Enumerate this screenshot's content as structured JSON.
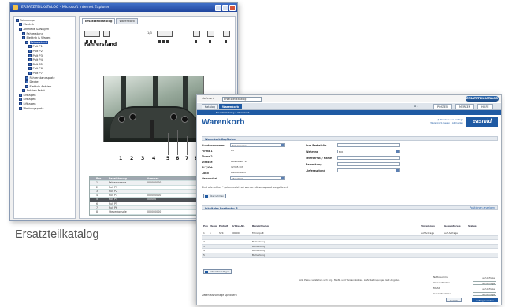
{
  "catalog": {
    "window_title": "ERSATZTEILKATALOG - Microsoft Internet Explorer",
    "tabs": [
      "Ersatzteilkatalog",
      "Warenkorb"
    ],
    "page_counter": "1/3",
    "section_title": "Fahrerstand",
    "callouts": [
      "1",
      "2",
      "3",
      "4",
      "5",
      "6",
      "7",
      "8",
      "9"
    ],
    "tree": [
      {
        "label": "Fahrzeuge",
        "indent": 0
      },
      {
        "label": "Elektrik",
        "indent": 1
      },
      {
        "label": "Antriebe & Wagen",
        "indent": 1
      },
      {
        "label": "Fahrerstand",
        "indent": 2
      },
      {
        "label": "Elektrik & Wagen",
        "indent": 2
      },
      {
        "label": "Fahrerstand",
        "indent": 3,
        "selected": true
      },
      {
        "label": "Pult P1",
        "indent": 4
      },
      {
        "label": "Pult P2",
        "indent": 4
      },
      {
        "label": "Pult P3",
        "indent": 4
      },
      {
        "label": "Pult P4",
        "indent": 4
      },
      {
        "label": "Pult P5",
        "indent": 4
      },
      {
        "label": "Pult P6",
        "indent": 4
      },
      {
        "label": "Pult P7",
        "indent": 4
      },
      {
        "label": "Fahrerstandsplatz",
        "indent": 3
      },
      {
        "label": "Decke",
        "indent": 3
      },
      {
        "label": "Elektrik Antrieb",
        "indent": 3
      },
      {
        "label": "Antrieb Fahrt",
        "indent": 2
      },
      {
        "label": "Lifttagen",
        "indent": 1
      },
      {
        "label": "Lifttagen",
        "indent": 1
      },
      {
        "label": "Lifttagen",
        "indent": 1
      },
      {
        "label": "Wartungsplatz",
        "indent": 1
      }
    ],
    "parts_table": {
      "header": [
        "",
        "Pos.",
        "Bezeichnung",
        "Nummer"
      ],
      "rows": [
        [
          "",
          "1",
          "Fahrerkonsole",
          "000000000"
        ],
        [
          "",
          "2",
          "Pult P1",
          ""
        ],
        [
          "",
          "3",
          "Pult P2",
          ""
        ],
        [
          "",
          "4",
          "Pult P3",
          "000000000"
        ],
        [
          "",
          "5",
          "Pult P4",
          "000000"
        ],
        [
          "",
          "6",
          "Pult P5",
          ""
        ],
        [
          "",
          "7",
          "Pult P6",
          ""
        ],
        [
          "",
          "8",
          "Steuerkonsole",
          "000000000"
        ]
      ],
      "selected_row": 4
    },
    "caption": "Ersatzteilkatalog"
  },
  "cart": {
    "top_label": "Lieferant",
    "top_select": "Ersatzteilkatalog",
    "brand_badge": "ERSATZTEILKATALOG",
    "nav_tabs": [
      "Katalog",
      "Warenkorb"
    ],
    "nav_right": [
      "POSTEN",
      "MERKEN",
      "HILFE"
    ],
    "nav_icons": "⌂ ?",
    "breadcrumb": "Ersatzteilkatalog > Warenkorb",
    "title": "Warenkorb",
    "header_links": [
      "▶ Drucken der Anfrage",
      "Warenkorb leeren · Abmelden"
    ],
    "logo": "easmid",
    "section_order": "Warenkorb Kopfdaten",
    "fields_left": [
      {
        "label": "Kundennummer",
        "value": "Firmenname"
      },
      {
        "label": "Firma 1",
        "value": "Ad"
      },
      {
        "label": "Firma 2",
        "value": ""
      },
      {
        "label": "Strasse",
        "value": "Beispielstr. 12"
      },
      {
        "label": "PLZ/Ort",
        "value": "12345 Ort"
      },
      {
        "label": "Land",
        "value": "Deutschland"
      },
      {
        "label": "Versandart",
        "value": "Standard"
      }
    ],
    "fields_right": [
      {
        "label": "Ihre Bestell-Nr.",
        "value": ""
      },
      {
        "label": "Wahrung",
        "value": "EUR"
      },
      {
        "label": "Telefon-Nr. / Name",
        "value": ""
      },
      {
        "label": "Bemerkung",
        "value": ""
      },
      {
        "label": "Lieferzustand",
        "value": ""
      }
    ],
    "versand_note": "Sind alle Artikel * gekennzeichnet werden diese separat ausgeliefert.",
    "apply_button": "Übernehmen",
    "section_positions": "Inhalt des Postkorbs: 5",
    "positions_link": "Positionen anzeigen",
    "columns": [
      "Pos.",
      "Menge",
      "Einheit",
      "Artikel-Nr.",
      "Bezeichnung",
      "",
      "Einzelpreis",
      "Gesamtpreis",
      "Status"
    ],
    "rows": [
      [
        "1",
        "1",
        "STK",
        "000000",
        "Fahrerpult",
        "",
        "auf Anfrage",
        "auf Anfrage",
        ""
      ],
      [
        "",
        "",
        "",
        "",
        "",
        "",
        "",
        "",
        ""
      ],
      [
        "2",
        "",
        "",
        "",
        "Bemerkung",
        "",
        "",
        "",
        ""
      ],
      [
        "3",
        "",
        "",
        "",
        "Bemerkung",
        "",
        "",
        "",
        ""
      ],
      [
        "4",
        "",
        "",
        "",
        "Bemerkung",
        "",
        "",
        "",
        ""
      ],
      [
        "5",
        "",
        "",
        "",
        "Bemerkung",
        "",
        "",
        "",
        ""
      ]
    ],
    "add_button": "Artikel hinzufügen",
    "note": "Alle Preise verstehen sich zzgl. MwSt. und Versandkosten. Lieferbedingungen laut Angebot.",
    "totals": [
      {
        "label": "Nettosumme",
        "value": "auf Anfrage"
      },
      {
        "label": "Versandkosten",
        "value": "auf Anfrage"
      },
      {
        "label": "MwSt.",
        "value": "auf Anfrage"
      },
      {
        "label": "Gesamtsumme",
        "value": "auf Anfrage"
      }
    ],
    "bottom_label": "Daten als Vorlage speichern",
    "footer_buttons": [
      "Zurück",
      "Anfrage senden"
    ]
  }
}
